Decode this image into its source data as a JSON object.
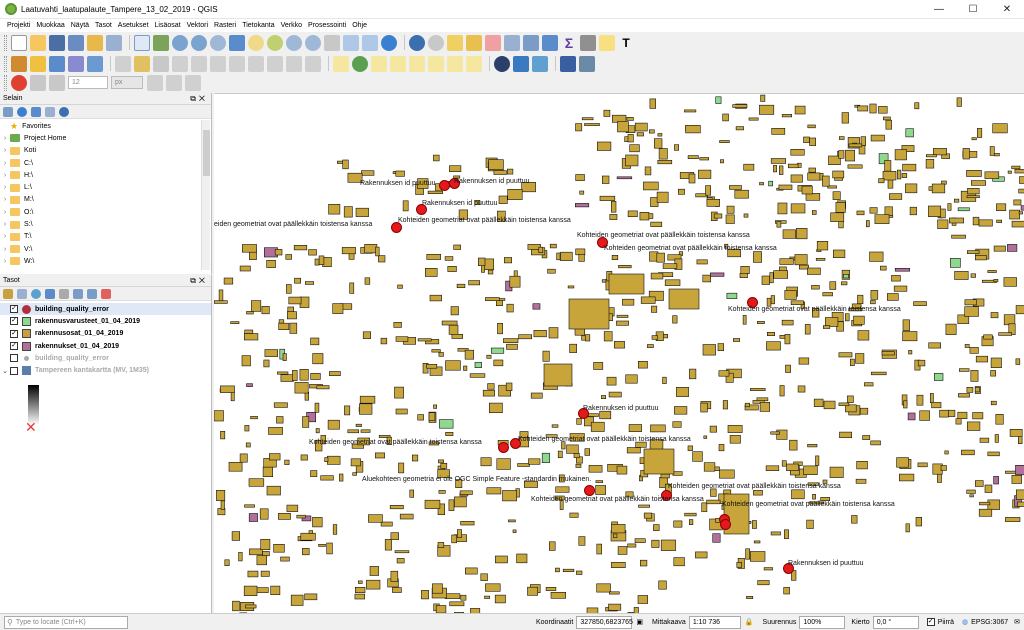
{
  "window": {
    "title": "Laatuvahti_laatupalaute_Tampere_13_02_2019 - QGIS",
    "minimize": "—",
    "maximize": "☐",
    "close": "✕"
  },
  "menu": [
    "Projekti",
    "Muokkaa",
    "Näytä",
    "Tasot",
    "Asetukset",
    "Lisäosat",
    "Vektori",
    "Rasteri",
    "Tietokanta",
    "Verkko",
    "Prosessointi",
    "Ohje"
  ],
  "toolbar3": {
    "font_size": "12",
    "unit": "px"
  },
  "browser": {
    "title": "Selain",
    "items": [
      {
        "label": "Favorites",
        "icon": "star-icon"
      },
      {
        "label": "Project Home",
        "icon": "home-icon"
      },
      {
        "label": "Koti",
        "icon": "folder-icon"
      },
      {
        "label": "C:\\",
        "icon": "folder-icon"
      },
      {
        "label": "H:\\",
        "icon": "folder-icon"
      },
      {
        "label": "L:\\",
        "icon": "folder-icon"
      },
      {
        "label": "M:\\",
        "icon": "folder-icon"
      },
      {
        "label": "O:\\",
        "icon": "folder-icon"
      },
      {
        "label": "S:\\",
        "icon": "folder-icon"
      },
      {
        "label": "T:\\",
        "icon": "folder-icon"
      },
      {
        "label": "V:\\",
        "icon": "folder-icon"
      },
      {
        "label": "W:\\",
        "icon": "folder-icon"
      }
    ]
  },
  "layers": {
    "title": "Tasot",
    "items": [
      {
        "label": "building_quality_error",
        "checked": true,
        "symbol": "#b03040",
        "style": "bold"
      },
      {
        "label": "rakennusvarusteet_01_04_2019",
        "checked": true,
        "symbol": "#8fd88f",
        "style": "bold"
      },
      {
        "label": "rakennusosat_01_04_2019",
        "checked": true,
        "symbol": "#c8a040",
        "style": "bold"
      },
      {
        "label": "rakennukset_01_04_2019",
        "checked": true,
        "symbol": "#b0709a",
        "style": "bold"
      },
      {
        "label": "building_quality_error",
        "checked": false,
        "symbol": "#aaaaaa",
        "style": "faded"
      },
      {
        "label": "Tampereen kantakartta (MV, 1M35)",
        "checked": false,
        "symbol": "#5a7fa8",
        "style": "faded"
      }
    ]
  },
  "map": {
    "labels": [
      "Rakennuksen id puuttuu",
      "Rakennuksen id puuttuu",
      "Rakennuksen id puuttuu",
      "eiden geometriat ovat päällekkäin toistensa kanssa",
      "Kohteiden geometriat ovat päällekkäin toistensa kanssa",
      "Kohteiden geometriat ovat päällekkäin toistensa kanssa",
      "Kohteiden geometriat ovat päällekkäin toistensa kanssa",
      "Kohteiden geometriat ovat päällekkäin toistensa kanssa",
      "Rakennuksen id puuttuu",
      "Kohteiden geometriat ovat päällekkäin toistensa kanssa",
      "Kohteiden geometriat ovat päällekkäin toistensa kanssa",
      "Aluekohteen geometria ei ole OGC Simple Feature -standardin mukainen.",
      "Kohteiden geometriat ovat päällekkäin toistensa kanssa",
      "Kohteiden geometriat ovat päällekkäin toistensa kanssa",
      "Kohteiden geometriat ovat päällekkäin toistensa kanssa",
      "Rakennuksen id puuttuu"
    ],
    "building_fill": "#c8a53a",
    "error_color": "#e31a1c"
  },
  "status": {
    "locator_placeholder": "Type to locate (Ctrl+K)",
    "coord_label": "Koordinaatit",
    "coord_value": "327850,6823765",
    "scale_label": "Mittakaava",
    "scale_value": "1:10 736",
    "magnifier_label": "Suurennus",
    "magnifier_value": "100%",
    "rotation_label": "Kierto",
    "rotation_value": "0,0 °",
    "render_label": "Piirrä",
    "crs": "EPSG:3067"
  }
}
